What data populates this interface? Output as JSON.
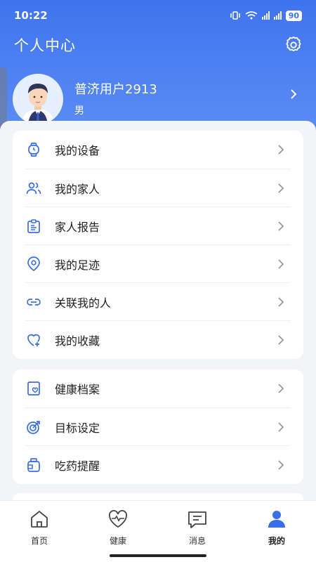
{
  "status_bar": {
    "time": "10:22",
    "battery": "90"
  },
  "header": {
    "title": "个人中心"
  },
  "profile": {
    "name": "普济用户2913",
    "gender": "男"
  },
  "menu_group_1": [
    {
      "label": "我的设备",
      "icon": "watch-icon"
    },
    {
      "label": "我的家人",
      "icon": "family-icon"
    },
    {
      "label": "家人报告",
      "icon": "report-icon"
    },
    {
      "label": "我的足迹",
      "icon": "location-icon"
    },
    {
      "label": "关联我的人",
      "icon": "link-icon"
    },
    {
      "label": "我的收藏",
      "icon": "heart-plus-icon"
    }
  ],
  "menu_group_2": [
    {
      "label": "健康档案",
      "icon": "health-file-icon"
    },
    {
      "label": "目标设定",
      "icon": "target-icon"
    },
    {
      "label": "吃药提醒",
      "icon": "medicine-icon"
    }
  ],
  "tabs": [
    {
      "label": "首页",
      "icon": "home-icon"
    },
    {
      "label": "健康",
      "icon": "heart-pulse-icon"
    },
    {
      "label": "消息",
      "icon": "message-icon"
    },
    {
      "label": "我的",
      "icon": "person-icon",
      "active": true
    }
  ],
  "colors": {
    "brand": "#3f73ee",
    "icon_blue": "#3a6ee8"
  }
}
